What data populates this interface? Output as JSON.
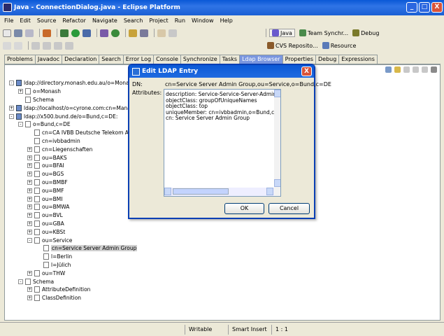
{
  "window": {
    "title": "Java - ConnectionDialog.java - Eclipse Platform",
    "min": "_",
    "max": "□",
    "close": "X"
  },
  "menu": [
    "File",
    "Edit",
    "Source",
    "Refactor",
    "Navigate",
    "Search",
    "Project",
    "Run",
    "Window",
    "Help"
  ],
  "perspectives": [
    {
      "label": "Java",
      "icon": "java-perspective-icon"
    },
    {
      "label": "Team Synchr...",
      "icon": "team-icon"
    },
    {
      "label": "Debug",
      "icon": "debug-icon"
    },
    {
      "label": "CVS Reposito...",
      "icon": "cvs-icon"
    },
    {
      "label": "Resource",
      "icon": "resource-icon"
    }
  ],
  "tabs": [
    "Problems",
    "Javadoc",
    "Declaration",
    "Search",
    "Error Log",
    "Console",
    "Synchronize",
    "Tasks",
    "Ldap Browser",
    "Properties",
    "Debug",
    "Expressions"
  ],
  "tree": [
    {
      "label": "ldap://directory.monash.edu.au/o=Monash",
      "level": 0,
      "toggle": "-",
      "icon": "server"
    },
    {
      "label": "o=Monash",
      "level": 1,
      "toggle": "+",
      "icon": "entry"
    },
    {
      "label": "Schema",
      "level": 1,
      "toggle": "none",
      "icon": "entry"
    },
    {
      "label": "ldap://localhost/o=cyrone.com:cn=Manager",
      "level": 0,
      "toggle": "+",
      "icon": "server"
    },
    {
      "label": "ldap://x500.bund.de/o=Bund,c=DE:",
      "level": 0,
      "toggle": "-",
      "icon": "server"
    },
    {
      "label": "o=Bund,c=DE",
      "level": 1,
      "toggle": "-",
      "icon": "entry"
    },
    {
      "label": "cn=CA IVBB Deutsche Telekom AG",
      "level": 2,
      "toggle": "none",
      "icon": "entry"
    },
    {
      "label": "cn=ivbbadmin",
      "level": 2,
      "toggle": "none",
      "icon": "entry"
    },
    {
      "label": "cn=Liegenschaften",
      "level": 2,
      "toggle": "+",
      "icon": "entry"
    },
    {
      "label": "ou=BAKS",
      "level": 2,
      "toggle": "+",
      "icon": "entry"
    },
    {
      "label": "ou=BFAI",
      "level": 2,
      "toggle": "+",
      "icon": "entry"
    },
    {
      "label": "ou=BGS",
      "level": 2,
      "toggle": "+",
      "icon": "entry"
    },
    {
      "label": "ou=BMBF",
      "level": 2,
      "toggle": "+",
      "icon": "entry"
    },
    {
      "label": "ou=BMF",
      "level": 2,
      "toggle": "+",
      "icon": "entry"
    },
    {
      "label": "ou=BMI",
      "level": 2,
      "toggle": "+",
      "icon": "entry"
    },
    {
      "label": "ou=BMWA",
      "level": 2,
      "toggle": "+",
      "icon": "entry"
    },
    {
      "label": "ou=BVL",
      "level": 2,
      "toggle": "+",
      "icon": "entry"
    },
    {
      "label": "ou=GBA",
      "level": 2,
      "toggle": "+",
      "icon": "entry"
    },
    {
      "label": "ou=KBSt",
      "level": 2,
      "toggle": "+",
      "icon": "entry"
    },
    {
      "label": "ou=Service",
      "level": 2,
      "toggle": "-",
      "icon": "entry"
    },
    {
      "label": "cn=Service Server Admin Group",
      "level": 3,
      "toggle": "none",
      "icon": "entry",
      "selected": true
    },
    {
      "label": "l=Berlin",
      "level": 3,
      "toggle": "none",
      "icon": "entry"
    },
    {
      "label": "l=Jülich",
      "level": 3,
      "toggle": "none",
      "icon": "entry"
    },
    {
      "label": "ou=THW",
      "level": 2,
      "toggle": "+",
      "icon": "entry"
    },
    {
      "label": "Schema",
      "level": 1,
      "toggle": "-",
      "icon": "entry"
    },
    {
      "label": "AttributeDefinition",
      "level": 2,
      "toggle": "+",
      "icon": "entry"
    },
    {
      "label": "ClassDefinition",
      "level": 2,
      "toggle": "+",
      "icon": "entry"
    }
  ],
  "dialog": {
    "title": "Edit LDAP Entry",
    "dn_label": "DN:",
    "dn_value": "cn=Service Server Admin Group,ou=Service,o=Bund,c=DE",
    "attributes_label": "Attributes:",
    "attributes": [
      "description: Service-Service-Server-Admin",
      "objectClass: groupOfUniqueNames",
      "objectClass: top",
      "uniqueMember: cn=ivbbadmin,o=Bund,c=",
      "cn: Service Server Admin Group"
    ],
    "ok": "OK",
    "cancel": "Cancel"
  },
  "status": {
    "mode": "Writable",
    "insert": "Smart Insert",
    "position": "1 : 1"
  }
}
